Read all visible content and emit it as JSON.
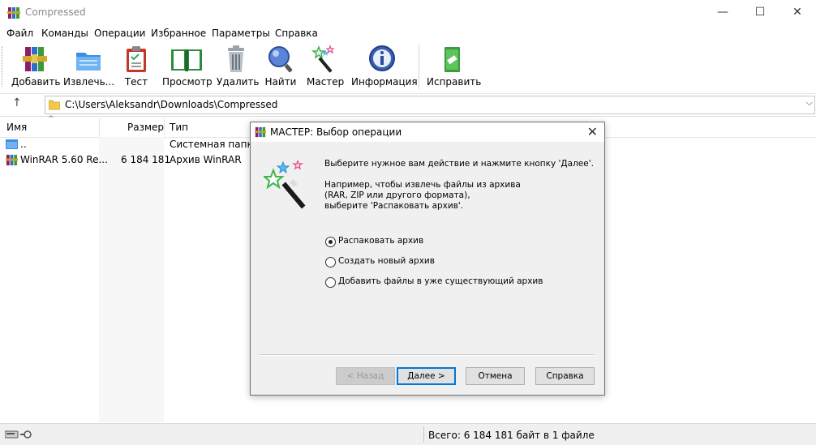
{
  "window": {
    "title": "Compressed",
    "minimize_glyph": "—",
    "maximize_glyph": "☐",
    "close_glyph": "✕"
  },
  "menu": [
    "Файл",
    "Команды",
    "Операции",
    "Избранное",
    "Параметры",
    "Справка"
  ],
  "toolbar": {
    "add": "Добавить",
    "extract": "Извлечь...",
    "test": "Тест",
    "view": "Просмотр",
    "delete": "Удалить",
    "find": "Найти",
    "wizard": "Мастер",
    "info": "Информация",
    "repair": "Исправить"
  },
  "address": {
    "path": "C:\\Users\\Aleksandr\\Downloads\\Compressed",
    "up_glyph": "↑",
    "dropdown_glyph": "⌵"
  },
  "columns": {
    "name": "Имя",
    "size": "Размер",
    "type": "Тип"
  },
  "rows": [
    {
      "name": "..",
      "size": "",
      "type": "Системная папка"
    },
    {
      "name": "WinRAR 5.60 Re...",
      "size": "6 184 181",
      "type": "Архив WinRAR"
    }
  ],
  "status": {
    "text": "Всего: 6 184 181 байт в 1 файле"
  },
  "dialog": {
    "title": "МАСТЕР:  Выбор операции",
    "close_glyph": "✕",
    "line1": "Выберите нужное вам действие и нажмите кнопку 'Далее'.",
    "line2": "Например, чтобы извлечь файлы из архива",
    "line3": "(RAR, ZIP или другого формата),",
    "line4": "выберите 'Распаковать архив'.",
    "options": [
      {
        "label": "Распаковать архив",
        "selected": true
      },
      {
        "label": "Создать новый архив",
        "selected": false
      },
      {
        "label": "Добавить файлы в уже существующий архив",
        "selected": false
      }
    ],
    "buttons": {
      "back": "< Назад",
      "next": "Далее >",
      "cancel": "Отмена",
      "help": "Справка"
    }
  }
}
